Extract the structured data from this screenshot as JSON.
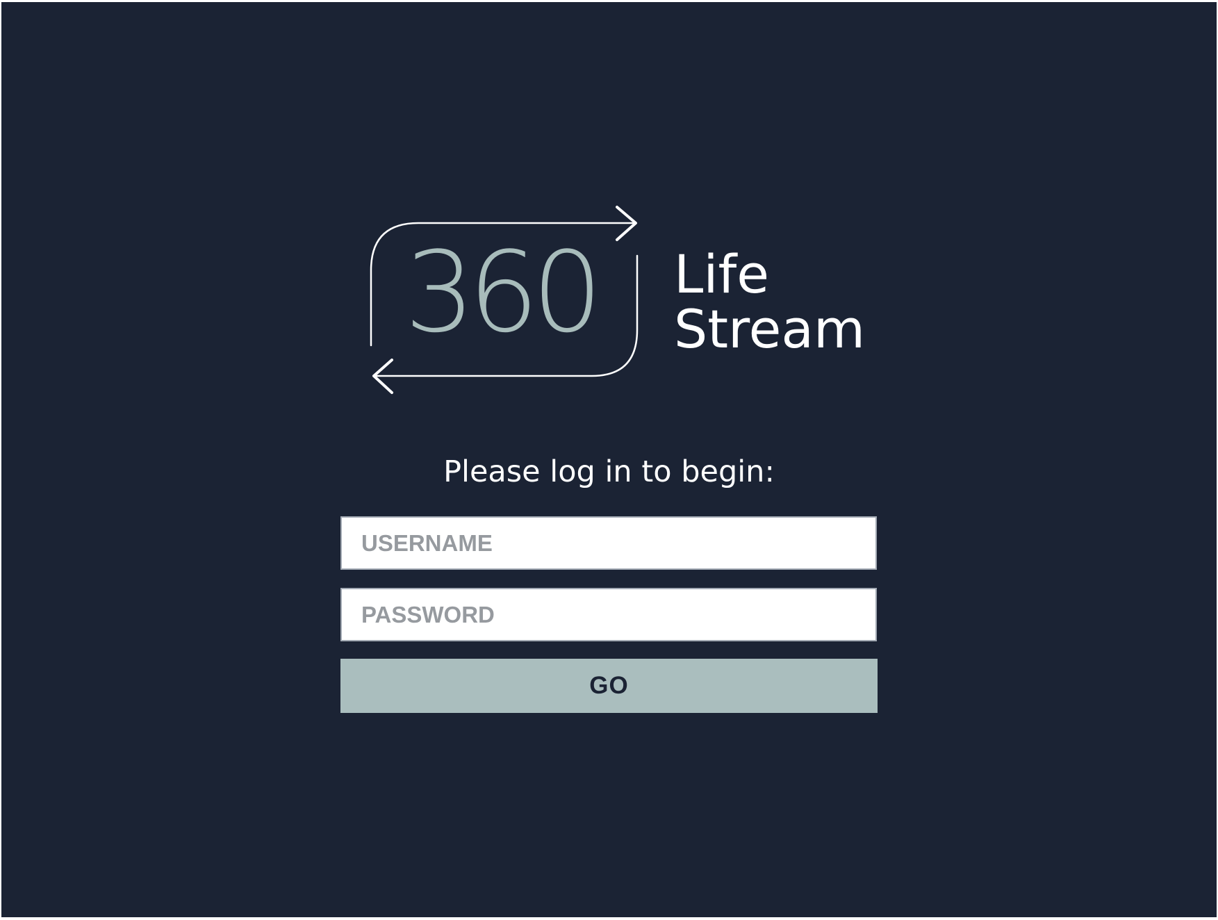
{
  "colors": {
    "background": "#1b2334",
    "accent": "#aabebe",
    "logo_number": "#a8bcbb",
    "text": "#ffffff",
    "placeholder": "#969a9f"
  },
  "logo": {
    "number": "360",
    "word_line1": "Life",
    "word_line2": "Stream",
    "icon": "circular-arrows-icon"
  },
  "login": {
    "prompt": "Please log in to begin:",
    "username": {
      "placeholder": "USERNAME",
      "value": ""
    },
    "password": {
      "placeholder": "PASSWORD",
      "value": ""
    },
    "submit_label": "GO"
  }
}
